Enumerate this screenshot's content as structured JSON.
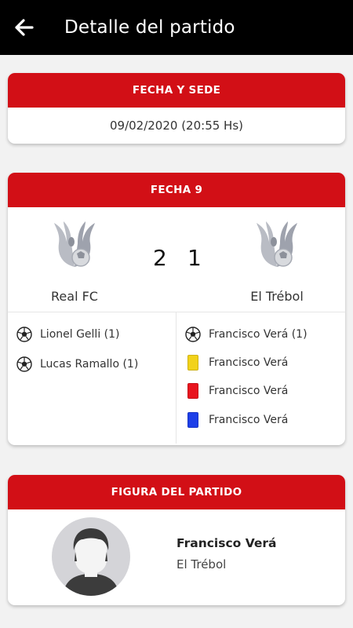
{
  "app_bar": {
    "title": "Detalle del partido",
    "back_icon": "arrow-left-icon"
  },
  "venue_card": {
    "header": "FECHA Y SEDE",
    "datetime": "09/02/2020 (20:55 Hs)"
  },
  "match_card": {
    "header": "FECHA 9",
    "home": {
      "name": "Real FC",
      "score": "2",
      "crest_icon": "phoenix-crest-icon"
    },
    "away": {
      "name": "El Trébol",
      "score": "1",
      "crest_icon": "phoenix-crest-icon"
    },
    "home_events": [
      {
        "type": "goal",
        "icon": "soccer-ball-icon",
        "text": "Lionel Gelli (1)"
      },
      {
        "type": "goal",
        "icon": "soccer-ball-icon",
        "text": "Lucas Ramallo (1)"
      }
    ],
    "away_events": [
      {
        "type": "goal",
        "icon": "soccer-ball-icon",
        "text": "Francisco Verá (1)"
      },
      {
        "type": "yellow-card",
        "icon": "yellow-card-icon",
        "text": "Francisco Verá"
      },
      {
        "type": "red-card",
        "icon": "red-card-icon",
        "text": "Francisco Verá"
      },
      {
        "type": "blue-card",
        "icon": "blue-card-icon",
        "text": "Francisco Verá"
      }
    ]
  },
  "figure_card": {
    "header": "FIGURA DEL PARTIDO",
    "player_name": "Francisco Verá",
    "player_team": "El Trébol",
    "avatar_icon": "player-avatar-icon"
  },
  "colors": {
    "app_bar": "#000000",
    "accent": "#d20f16",
    "yellow_card": "#f2d21a",
    "red_card": "#e8141e",
    "blue_card": "#1d3fe8"
  }
}
